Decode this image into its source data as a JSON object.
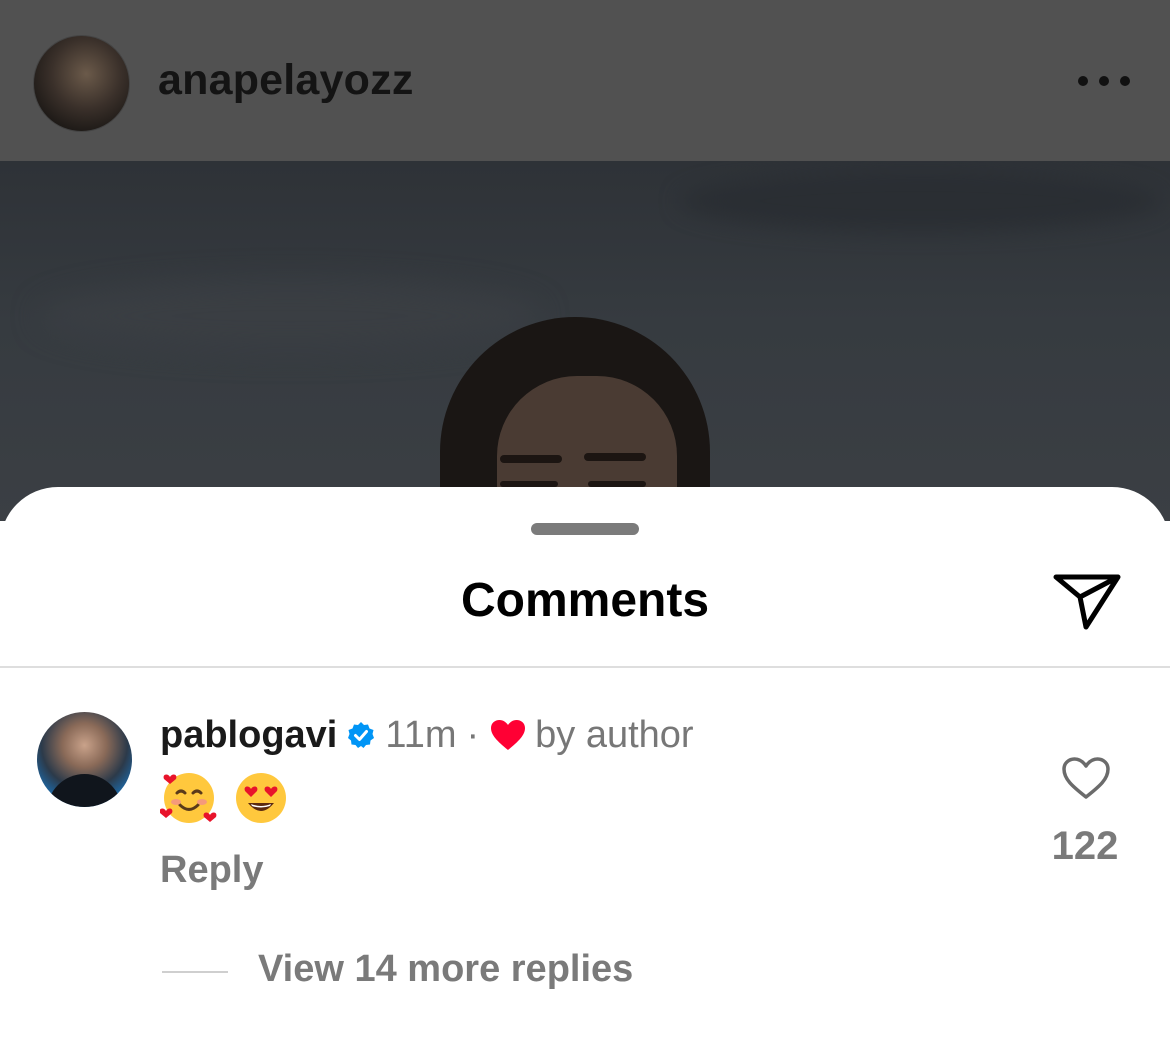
{
  "post": {
    "username": "anapelayozz",
    "more_icon": "more-horizontal-icon"
  },
  "comments_sheet": {
    "title": "Comments",
    "share_icon": "paper-plane-icon",
    "comment": {
      "username": "pablogavi",
      "verified": true,
      "time": "11m",
      "separator": "·",
      "liked_by_author_label": "by author",
      "emojis": [
        "smiling-face-with-hearts",
        "smiling-face-with-heart-eyes"
      ],
      "reply_label": "Reply",
      "like_count": "122"
    },
    "view_replies_label": "View 14 more replies"
  },
  "colors": {
    "verified_blue": "#0095f6",
    "heart_red": "#ff0034",
    "secondary_text": "#777777"
  }
}
